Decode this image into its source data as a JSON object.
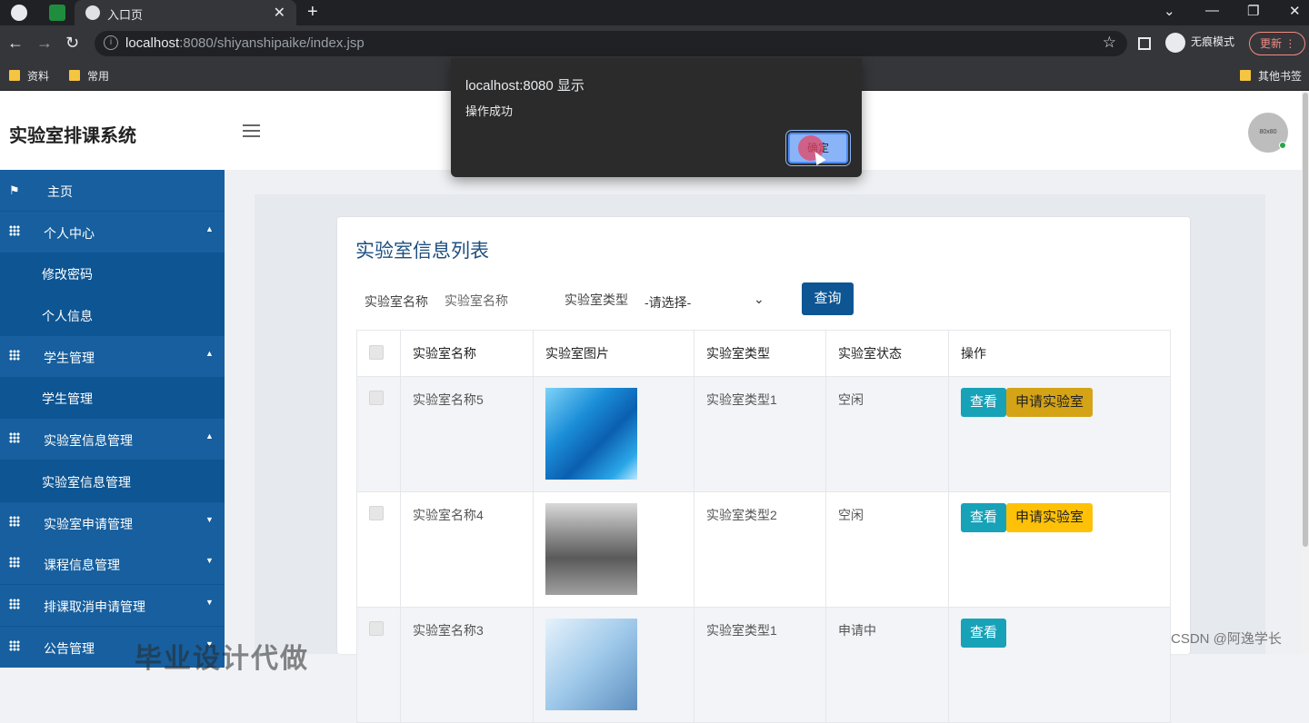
{
  "browser": {
    "active_tab_title": "入口页",
    "url_host": "localhost",
    "url_rest": ":8080/shiyanshipaike/index.jsp",
    "incognito_label": "无痕模式",
    "update_label": "更新",
    "bookmarks": [
      "资料",
      "常用"
    ],
    "other_bookmarks": "其他书签"
  },
  "app": {
    "brand": "实验室排课系统",
    "avatar_text": "80x80"
  },
  "sidebar": {
    "items": [
      {
        "label": "主页",
        "type": "menu"
      },
      {
        "label": "个人中心",
        "type": "menu"
      },
      {
        "label": "修改密码",
        "type": "sub"
      },
      {
        "label": "个人信息",
        "type": "sub"
      },
      {
        "label": "学生管理",
        "type": "menu"
      },
      {
        "label": "学生管理",
        "type": "sub"
      },
      {
        "label": "实验室信息管理",
        "type": "menu"
      },
      {
        "label": "实验室信息管理",
        "type": "sub"
      },
      {
        "label": "实验室申请管理",
        "type": "menu"
      },
      {
        "label": "课程信息管理",
        "type": "menu"
      },
      {
        "label": "排课取消申请管理",
        "type": "menu"
      },
      {
        "label": "公告管理",
        "type": "menu"
      }
    ]
  },
  "main": {
    "title": "实验室信息列表",
    "filter": {
      "name_label": "实验室名称",
      "name_placeholder": "实验室名称",
      "type_label": "实验室类型",
      "type_selected": "-请选择-",
      "query_button": "查询"
    },
    "table": {
      "headers": [
        "实验室名称",
        "实验室图片",
        "实验室类型",
        "实验室状态",
        "操作"
      ],
      "rows": [
        {
          "name": "实验室名称5",
          "type": "实验室类型1",
          "status": "空闲",
          "view": "查看",
          "apply": "申请实验室"
        },
        {
          "name": "实验室名称4",
          "type": "实验室类型2",
          "status": "空闲",
          "view": "查看",
          "apply": "申请实验室"
        },
        {
          "name": "实验室名称3",
          "type": "实验室类型1",
          "status": "申请中",
          "view": "查看"
        }
      ]
    }
  },
  "dialog": {
    "title": "localhost:8080 显示",
    "message": "操作成功",
    "ok_button": "确定"
  },
  "watermark": "CSDN @阿逸学长",
  "ghost_text": "毕业设计代做",
  "colors": {
    "sidebar_bg": "#0d5593",
    "primary": "#0d5593",
    "view_button": "#17a2b8",
    "apply_button": "#ffc107"
  }
}
